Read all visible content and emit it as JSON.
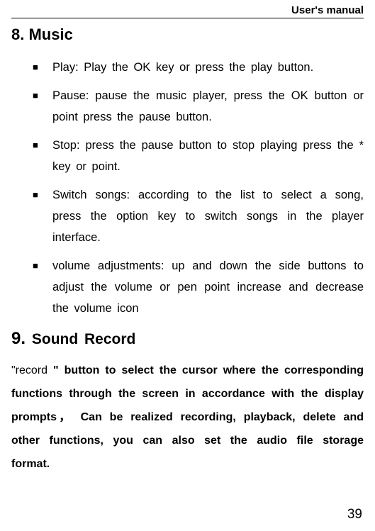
{
  "header": {
    "title": "User's manual"
  },
  "section1": {
    "number": "8.",
    "title": "Music",
    "items": [
      "Play: Play the OK key or press the play button.",
      "Pause: pause the music player, press the OK button or point press the pause button.",
      "Stop: press the pause button to stop playing press the * key or point.",
      "Switch songs: according to the list to select a song, press the option key to switch songs in the player interface.",
      "volume adjustments: up and down the side buttons to adjust the volume or pen point increase and decrease the volume icon"
    ]
  },
  "section2": {
    "number": "9.",
    "title": "Sound Record",
    "leadWord": "\"record ",
    "paragraph": "\" button to select the cursor where the corresponding functions through the screen in accordance with the display prompts， Can be realized recording, playback, delete and other functions, you can also set the audio file storage format."
  },
  "pageNumber": "39"
}
